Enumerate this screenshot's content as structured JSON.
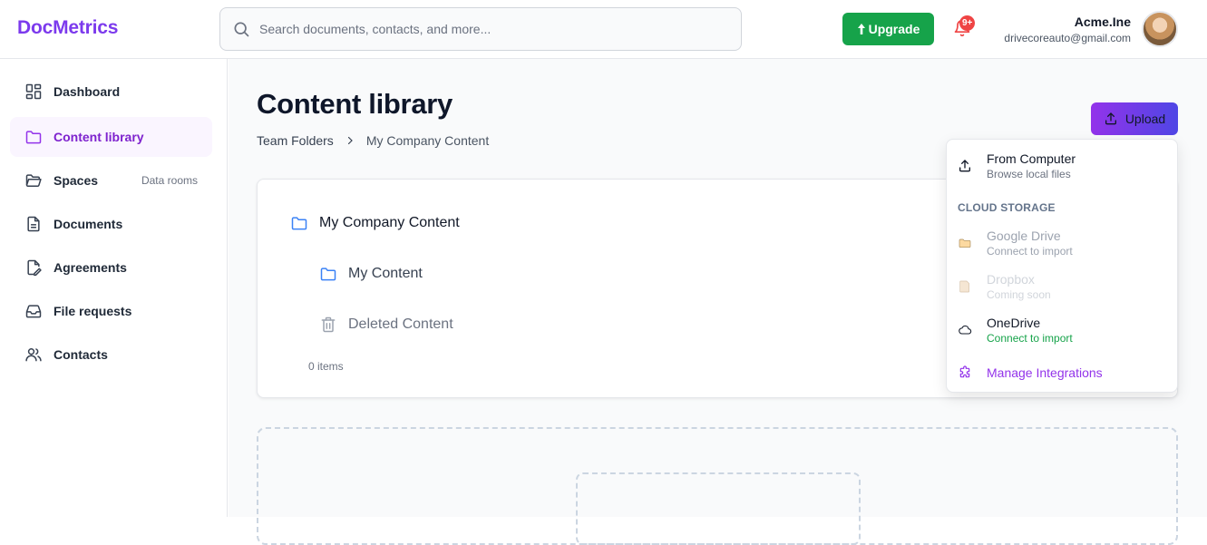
{
  "header": {
    "logo": "DocMetrics",
    "search_placeholder": "Search documents, contacts, and more...",
    "upgrade_label": "Upgrade",
    "notification_badge": "9+",
    "user_name": "Acme.Ine",
    "user_email": "drivecoreauto@gmail.com"
  },
  "sidebar": {
    "items": [
      {
        "label": "Dashboard",
        "icon": "grid-icon"
      },
      {
        "label": "Content library",
        "icon": "folder-icon",
        "active": true
      },
      {
        "label": "Spaces",
        "sub": "Data rooms",
        "icon": "folder-open-icon"
      },
      {
        "label": "Documents",
        "icon": "document-icon"
      },
      {
        "label": "Agreements",
        "icon": "edit-document-icon"
      },
      {
        "label": "File requests",
        "icon": "inbox-icon"
      },
      {
        "label": "Contacts",
        "icon": "users-icon"
      }
    ]
  },
  "main": {
    "title": "Content library",
    "breadcrumb": [
      "Team Folders",
      "My Company Content"
    ],
    "upload_label": "Upload",
    "tree": {
      "root": "My Company Content",
      "children": [
        "My Content",
        "Deleted Content"
      ],
      "items_count": "0 items"
    }
  },
  "upload_menu": {
    "from_computer": {
      "title": "From Computer",
      "sub": "Browse local files"
    },
    "section_label": "CLOUD STORAGE",
    "google_drive": {
      "title": "Google Drive",
      "sub": "Connect to import"
    },
    "dropbox": {
      "title": "Dropbox",
      "sub": "Coming soon"
    },
    "onedrive": {
      "title": "OneDrive",
      "sub": "Connect to import"
    },
    "manage_label": "Manage Integrations"
  },
  "colors": {
    "brand": "#7c3aed",
    "upgrade": "#16a34a",
    "active_nav_bg": "#faf5ff",
    "folder_icon": "#3b82f6"
  }
}
